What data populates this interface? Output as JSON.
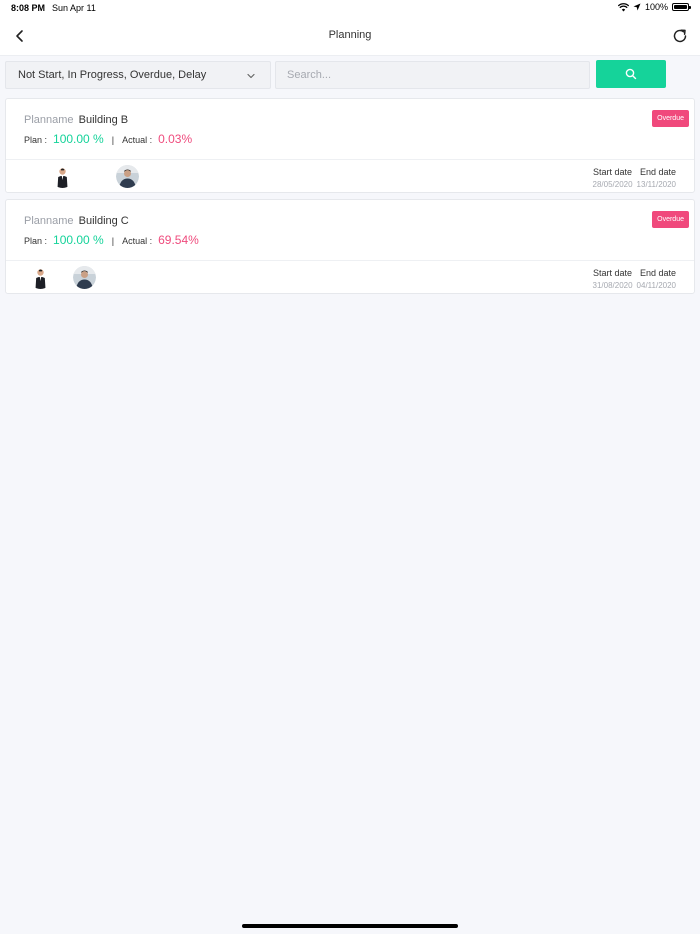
{
  "status_bar": {
    "time": "8:08 PM",
    "date": "Sun Apr 11",
    "battery": "100%"
  },
  "header": {
    "title": "Planning",
    "back_icon": "chevron-left-icon",
    "refresh_icon": "refresh-icon"
  },
  "filter": {
    "status_value": "Not Start, In Progress, Overdue, Delay",
    "search_placeholder": "Search...",
    "search_icon": "search-icon"
  },
  "labels": {
    "plan_name": "Planname",
    "plan": "Plan :",
    "separator": "|",
    "actual": "Actual :",
    "start_date": "Start date",
    "end_date": "End date"
  },
  "plans": [
    {
      "name": "Building B",
      "plan_percent": "100.00 %",
      "actual_percent": "0.03%",
      "status": "Overdue",
      "start_date": "28/05/2020",
      "end_date": "13/11/2020"
    },
    {
      "name": "Building C",
      "plan_percent": "100.00 %",
      "actual_percent": "69.54%",
      "status": "Overdue",
      "start_date": "31/08/2020",
      "end_date": "04/11/2020"
    }
  ],
  "colors": {
    "accent": "#15d39a",
    "overdue": "#f0497c",
    "actual": "#ef4b7d"
  }
}
